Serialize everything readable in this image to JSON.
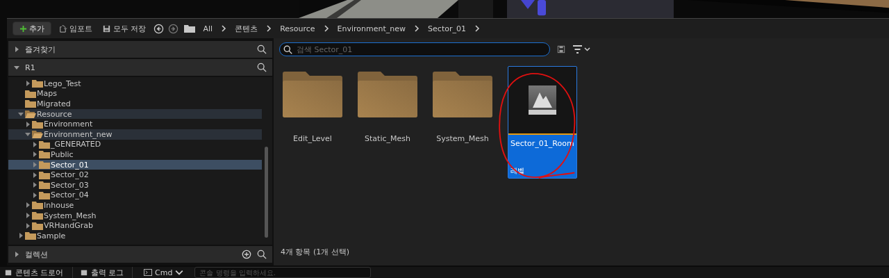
{
  "toolbar": {
    "add_button": "추가",
    "import_button": "임포트",
    "save_all_button": "모두 저장",
    "breadcrumbs": [
      "All",
      "콘텐츠",
      "Resource",
      "Environment_new",
      "Sector_01"
    ]
  },
  "sidebar": {
    "favorites": {
      "title": "즐겨찾기",
      "expanded": false
    },
    "project": {
      "title": "R1",
      "expanded": true
    },
    "tree": [
      {
        "children": [
          {
            "label": "Lego_Test",
            "has_children": true,
            "expanded": false,
            "selected": false,
            "highlighted": false
          }
        ]
      },
      {
        "label": "Maps",
        "has_children": false,
        "expanded": false,
        "selected": false,
        "highlighted": false
      },
      {
        "label": "Migrated",
        "has_children": false,
        "expanded": false,
        "selected": false,
        "highlighted": false
      },
      {
        "label": "Resource",
        "has_children": true,
        "expanded": true,
        "selected": false,
        "highlighted": true,
        "children": [
          {
            "label": "Environment",
            "has_children": true,
            "expanded": false,
            "selected": false,
            "highlighted": false
          },
          {
            "label": "Environment_new",
            "has_children": true,
            "expanded": true,
            "selected": false,
            "highlighted": true,
            "children": [
              {
                "label": "_GENERATED",
                "has_children": true,
                "expanded": false,
                "selected": false,
                "highlighted": false
              },
              {
                "label": "Public",
                "has_children": true,
                "expanded": false,
                "selected": false,
                "highlighted": false
              },
              {
                "label": "Sector_01",
                "has_children": true,
                "expanded": false,
                "selected": true,
                "highlighted": false
              },
              {
                "label": "Sector_02",
                "has_children": true,
                "expanded": false,
                "selected": false,
                "highlighted": false
              },
              {
                "label": "Sector_03",
                "has_children": true,
                "expanded": false,
                "selected": false,
                "highlighted": false
              },
              {
                "label": "Sector_04",
                "has_children": true,
                "expanded": false,
                "selected": false,
                "highlighted": false
              }
            ]
          },
          {
            "label": "Inhouse",
            "has_children": true,
            "expanded": false,
            "selected": false,
            "highlighted": false
          },
          {
            "label": "System_Mesh",
            "has_children": true,
            "expanded": false,
            "selected": false,
            "highlighted": false
          },
          {
            "label": "VRHandGrab",
            "has_children": true,
            "expanded": false,
            "selected": false,
            "highlighted": false
          }
        ]
      },
      {
        "label": "Sample",
        "has_children": true,
        "expanded": false,
        "selected": false,
        "highlighted": false
      }
    ],
    "collections": {
      "title": "컬렉션",
      "expanded": false
    }
  },
  "content": {
    "search": {
      "placeholder": "검색 Sector_01"
    },
    "items": [
      {
        "kind": "folder",
        "label": "Edit_Level",
        "selected": false
      },
      {
        "kind": "folder",
        "label": "Static_Mesh",
        "selected": false
      },
      {
        "kind": "folder",
        "label": "System_Mesh",
        "selected": false
      },
      {
        "kind": "level",
        "label": "Sector_01_Room",
        "type": "레벨",
        "selected": true
      }
    ],
    "status": "4개 항목 (1개 선택)"
  },
  "bottom_bar": {
    "tabs": [
      "콘텐츠 드로어",
      "출력 로그"
    ],
    "cmd_button": "Cmd",
    "console": {
      "placeholder": "콘솔 명령을 입력하세요."
    }
  }
}
